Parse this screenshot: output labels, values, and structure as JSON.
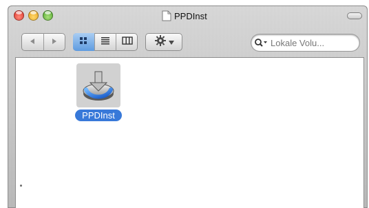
{
  "window": {
    "title": "PPDInst"
  },
  "toolbar": {
    "nav": {
      "back_icon": "back-arrow-icon",
      "forward_icon": "forward-arrow-icon"
    },
    "views": {
      "icon_view": "icon-view-icon",
      "list_view": "list-view-icon",
      "column_view": "column-view-icon",
      "active": "icon"
    },
    "action_icon": "gear-icon",
    "search": {
      "placeholder": "Lokale Volu..."
    }
  },
  "content": {
    "items": [
      {
        "label": "PPDInst",
        "icon": "installer-disk-icon",
        "selected": true
      }
    ]
  },
  "colors": {
    "selection": "#3879d9",
    "active_view": "#5e9be0"
  }
}
